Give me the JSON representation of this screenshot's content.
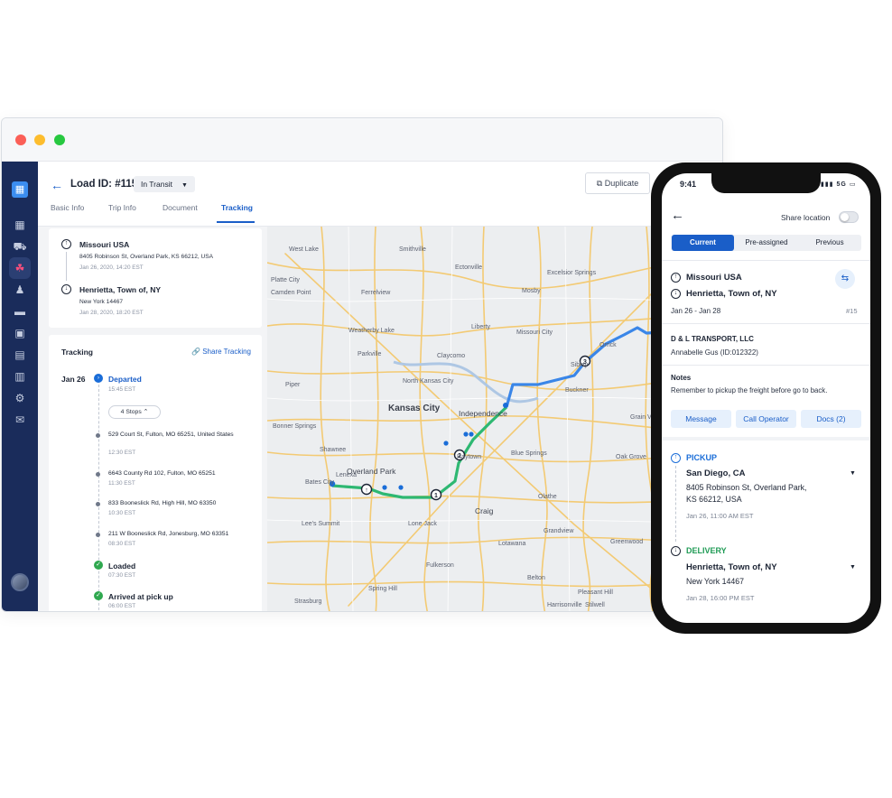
{
  "desktop": {
    "load_id": "Load ID: #115",
    "status": "In Transit",
    "duplicate_label": "Duplicate",
    "tabs": [
      "Basic Info",
      "Trip Info",
      "Document",
      "Tracking"
    ],
    "route": {
      "origin": {
        "name": "Missouri USA",
        "address": "8405 Robinson St, Overland Park, KS 66212, USA",
        "time": "Jan 26, 2020, 14:20 EST"
      },
      "destination": {
        "name": "Henrietta, Town of, NY",
        "address": "New York 14467",
        "time": "Jan 28, 2020, 18:20 EST"
      }
    },
    "tracking": {
      "title": "Tracking",
      "share_label": "Share Tracking",
      "date": "Jan 26",
      "departed": {
        "label": "Departed",
        "time": "15:45 EST"
      },
      "stops_label": "4 Stops",
      "stops": [
        {
          "address": "529 Court St, Fulton, MO 65251, United States",
          "time": "12:30 EST"
        },
        {
          "address": "6643 County Rd 102, Fulton, MO 65251",
          "time": "11:30 EST"
        },
        {
          "address": "833 Booneslick Rd, High Hill, MO 63350",
          "time": "10:30 EST"
        },
        {
          "address": "211 W Booneslick Rd, Jonesburg, MO 63351",
          "time": "08:30 EST"
        }
      ],
      "loaded": {
        "label": "Loaded",
        "time": "07:30 EST"
      },
      "arrived": {
        "label": "Arrived at pick up",
        "time": "06:00 EST"
      }
    },
    "map": {
      "city_label": "Kansas City",
      "labels": [
        "West Lake",
        "Smithville",
        "Ectonville",
        "Platte City",
        "Ferrelview",
        "Excelsior Springs",
        "Mosby",
        "Camden Point",
        "Weatherby Lake",
        "Liberty",
        "Orrick",
        "Parkville",
        "Claycomo",
        "Missouri City",
        "Sibley",
        "Piper",
        "North Kansas City",
        "Buckner",
        "Independence",
        "Bonner Springs",
        "Grain Valley",
        "Blue Springs",
        "Shawnee",
        "Lenexa",
        "Raytown",
        "Oak Grove",
        "Overland Park",
        "Bates City",
        "Craig",
        "Lee's Summit",
        "Olathe",
        "Lone Jack",
        "Grandview",
        "Lotawana",
        "Greenwood",
        "Fulkerson",
        "Belton",
        "Pleasant Hill",
        "Strasburg",
        "Spring Hill",
        "Stilwell",
        "Harrisonville"
      ],
      "colors": {
        "route_done": "#2eb872",
        "route_remaining": "#3a86e8",
        "roads": "#f0c266"
      }
    }
  },
  "phone": {
    "time": "9:41",
    "signal": "5G",
    "share_location": "Share location",
    "segments": [
      "Current",
      "Pre-assigned",
      "Previous"
    ],
    "origin": "Missouri USA",
    "destination": "Henrietta, Town of, NY",
    "dates": "Jan 26 - Jan 28",
    "number": "#15",
    "carrier": "D & L TRANSPORT, LLC",
    "operator": "Annabelle Gus (ID:012322)",
    "notes_title": "Notes",
    "notes": "Remember to pickup the freight before go to back.",
    "buttons": [
      "Message",
      "Call Operator",
      "Docs (2)"
    ],
    "pickup": {
      "title": "PICKUP",
      "city": "San Diego, CA",
      "address_line1": "8405 Robinson St, Overland Park,",
      "address_line2": "KS 66212, USA",
      "time": "Jan 26, 11:00 AM EST"
    },
    "delivery": {
      "title": "DELIVERY",
      "city": "Henrietta, Town of, NY",
      "address": "New York 14467",
      "time": "Jan 28, 16:00 PM EST"
    }
  }
}
